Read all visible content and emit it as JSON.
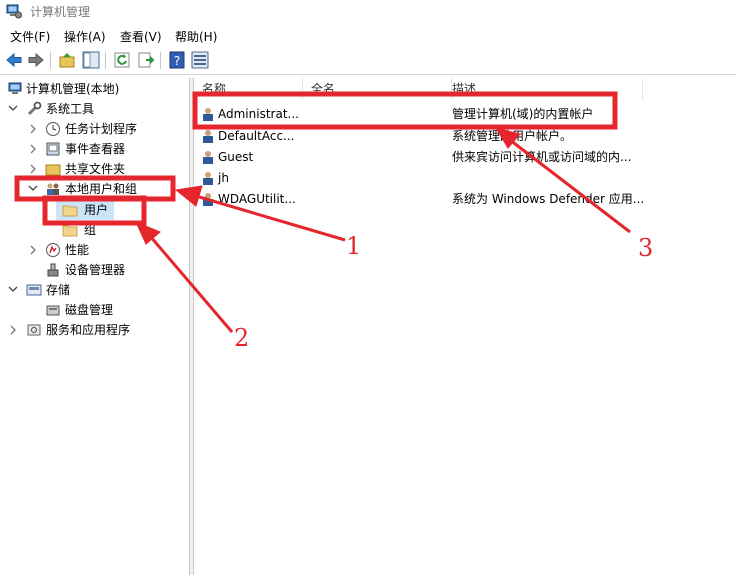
{
  "window": {
    "title": "计算机管理"
  },
  "menu": [
    "文件(F)",
    "操作(A)",
    "查看(V)",
    "帮助(H)"
  ],
  "toolbar": {
    "buttons": [
      "back-arrow-icon",
      "forward-arrow-icon",
      "up-folder-icon",
      "show-hide-tree-icon",
      "refresh-icon",
      "export-list-icon",
      "help-icon",
      "console-tree-icon"
    ]
  },
  "tree": {
    "root": "计算机管理(本地)",
    "system_tools": "系统工具",
    "task_scheduler": "任务计划程序",
    "event_viewer": "事件查看器",
    "shared_folders": "共享文件夹",
    "local_users_groups": "本地用户和组",
    "users": "用户",
    "groups": "组",
    "performance": "性能",
    "device_manager": "设备管理器",
    "storage": "存储",
    "disk_management": "磁盘管理",
    "services_apps": "服务和应用程序"
  },
  "columns": {
    "name": "名称",
    "fullname": "全名",
    "description": "描述"
  },
  "users": [
    {
      "name": "Administrat...",
      "description": "管理计算机(域)的内置帐户"
    },
    {
      "name": "DefaultAcc...",
      "description": "系统管理的用户帐户。"
    },
    {
      "name": "Guest",
      "description": "供来宾访问计算机或访问域的内..."
    },
    {
      "name": "jh",
      "description": ""
    },
    {
      "name": "WDAGUtilit...",
      "description": "系统为 Windows Defender 应用..."
    }
  ],
  "annotations": {
    "one": "1",
    "two": "2",
    "three": "3"
  },
  "colors": {
    "annotation_red": "#e5262c",
    "selection": "#cce4f7"
  }
}
